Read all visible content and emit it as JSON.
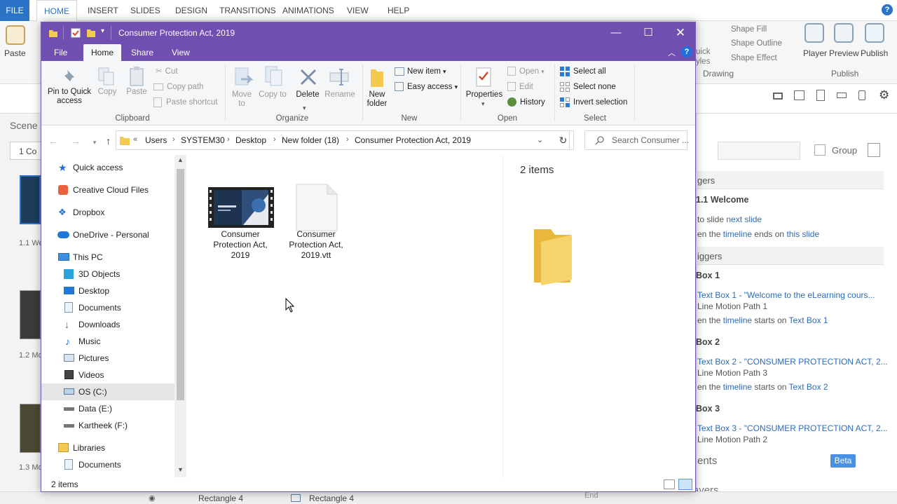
{
  "background_app": {
    "menu_tabs": [
      "FILE",
      "HOME",
      "INSERT",
      "SLIDES",
      "DESIGN",
      "TRANSITIONS",
      "ANIMATIONS",
      "VIEW",
      "HELP"
    ],
    "ribbon": {
      "paste": "Paste",
      "shape_fill": "Shape Fill",
      "shape_outline": "Shape Outline",
      "shape_effect": "Shape Effect",
      "drawing": "Drawing",
      "player": "Player",
      "preview": "Preview",
      "publish": "Publish",
      "publish_group": "Publish",
      "quick": "uick",
      "styles": "yles"
    },
    "left_panel": {
      "scenes": "Scene",
      "scene_dropdown": "1 Co",
      "slides": [
        "1.1 We",
        "1.2 Mo",
        "1.3 Mo"
      ]
    },
    "right_panel": {
      "group_label": "Group",
      "triggers_head": "gers",
      "welcome": "1.1 Welcome",
      "jump_line": {
        "pre": "to slide ",
        "link": "next slide"
      },
      "timeline_line": {
        "pre": "en the ",
        "link1": "timeline",
        "mid": " ends on ",
        "link2": "this slide"
      },
      "object_triggers_head": "iggers",
      "boxes": [
        {
          "title": "Box 1",
          "link": "Text Box 1 - \"Welcome to the eLearning cours...",
          "path": "Line Motion Path 1",
          "when": "en the ",
          "tl": "timeline",
          "starts": " starts on ",
          "target": "Text Box 1"
        },
        {
          "title": "Box 2",
          "link": "Text Box 2 - \"CONSUMER PROTECTION ACT, 2...",
          "path": "Line Motion Path 3",
          "when": "en the ",
          "tl": "timeline",
          "starts": " starts on ",
          "target": "Text Box 2"
        },
        {
          "title": "Box 3",
          "link": "Text Box 3 - \"CONSUMER PROTECTION ACT, 2...",
          "path": "Line Motion Path 2",
          "when": "",
          "tl": "",
          "starts": "",
          "target": ""
        }
      ],
      "ents": "ents",
      "beta": "Beta",
      "slide_layers": "Slide Layers"
    },
    "bottom": {
      "rect1": "Rectangle 4",
      "rect2": "Rectangle 4",
      "end": "End"
    }
  },
  "explorer": {
    "title": "Consumer Protection Act, 2019",
    "tabs": {
      "file": "File",
      "home": "Home",
      "share": "Share",
      "view": "View"
    },
    "ribbon": {
      "clipboard": {
        "pin": "Pin to Quick access",
        "copy": "Copy",
        "paste": "Paste",
        "cut": "Cut",
        "copy_path": "Copy path",
        "paste_shortcut": "Paste shortcut",
        "label": "Clipboard"
      },
      "organize": {
        "move_to": "Move to",
        "copy_to": "Copy to",
        "delete": "Delete",
        "rename": "Rename",
        "label": "Organize"
      },
      "new": {
        "new_folder": "New folder",
        "new_item": "New item",
        "easy_access": "Easy access",
        "label": "New"
      },
      "open": {
        "properties": "Properties",
        "open": "Open",
        "edit": "Edit",
        "history": "History",
        "label": "Open"
      },
      "select": {
        "select_all": "Select all",
        "select_none": "Select none",
        "invert": "Invert selection",
        "label": "Select"
      }
    },
    "address": {
      "crumbs": [
        "Users",
        "SYSTEM30",
        "Desktop",
        "New folder (18)",
        "Consumer Protection Act, 2019"
      ],
      "search_placeholder": "Search Consumer ..."
    },
    "nav": {
      "quick_access": "Quick access",
      "creative_cloud": "Creative Cloud Files",
      "dropbox": "Dropbox",
      "onedrive": "OneDrive - Personal",
      "this_pc": "This PC",
      "objects3d": "3D Objects",
      "desktop": "Desktop",
      "documents": "Documents",
      "downloads": "Downloads",
      "music": "Music",
      "pictures": "Pictures",
      "videos": "Videos",
      "os_c": "OS (C:)",
      "data_e": "Data (E:)",
      "kartheek_f": "Kartheek  (F:)",
      "libraries": "Libraries",
      "lib_documents": "Documents"
    },
    "files": [
      {
        "name": "Consumer Protection Act, 2019",
        "type": "video"
      },
      {
        "name": "Consumer Protection Act, 2019.vtt",
        "type": "document"
      }
    ],
    "preview_count": "2 items",
    "status": "2 items",
    "colors": {
      "titlebar": "#6f4faf",
      "accent": "#1e6fd9",
      "folder": "#f3c94f"
    }
  }
}
